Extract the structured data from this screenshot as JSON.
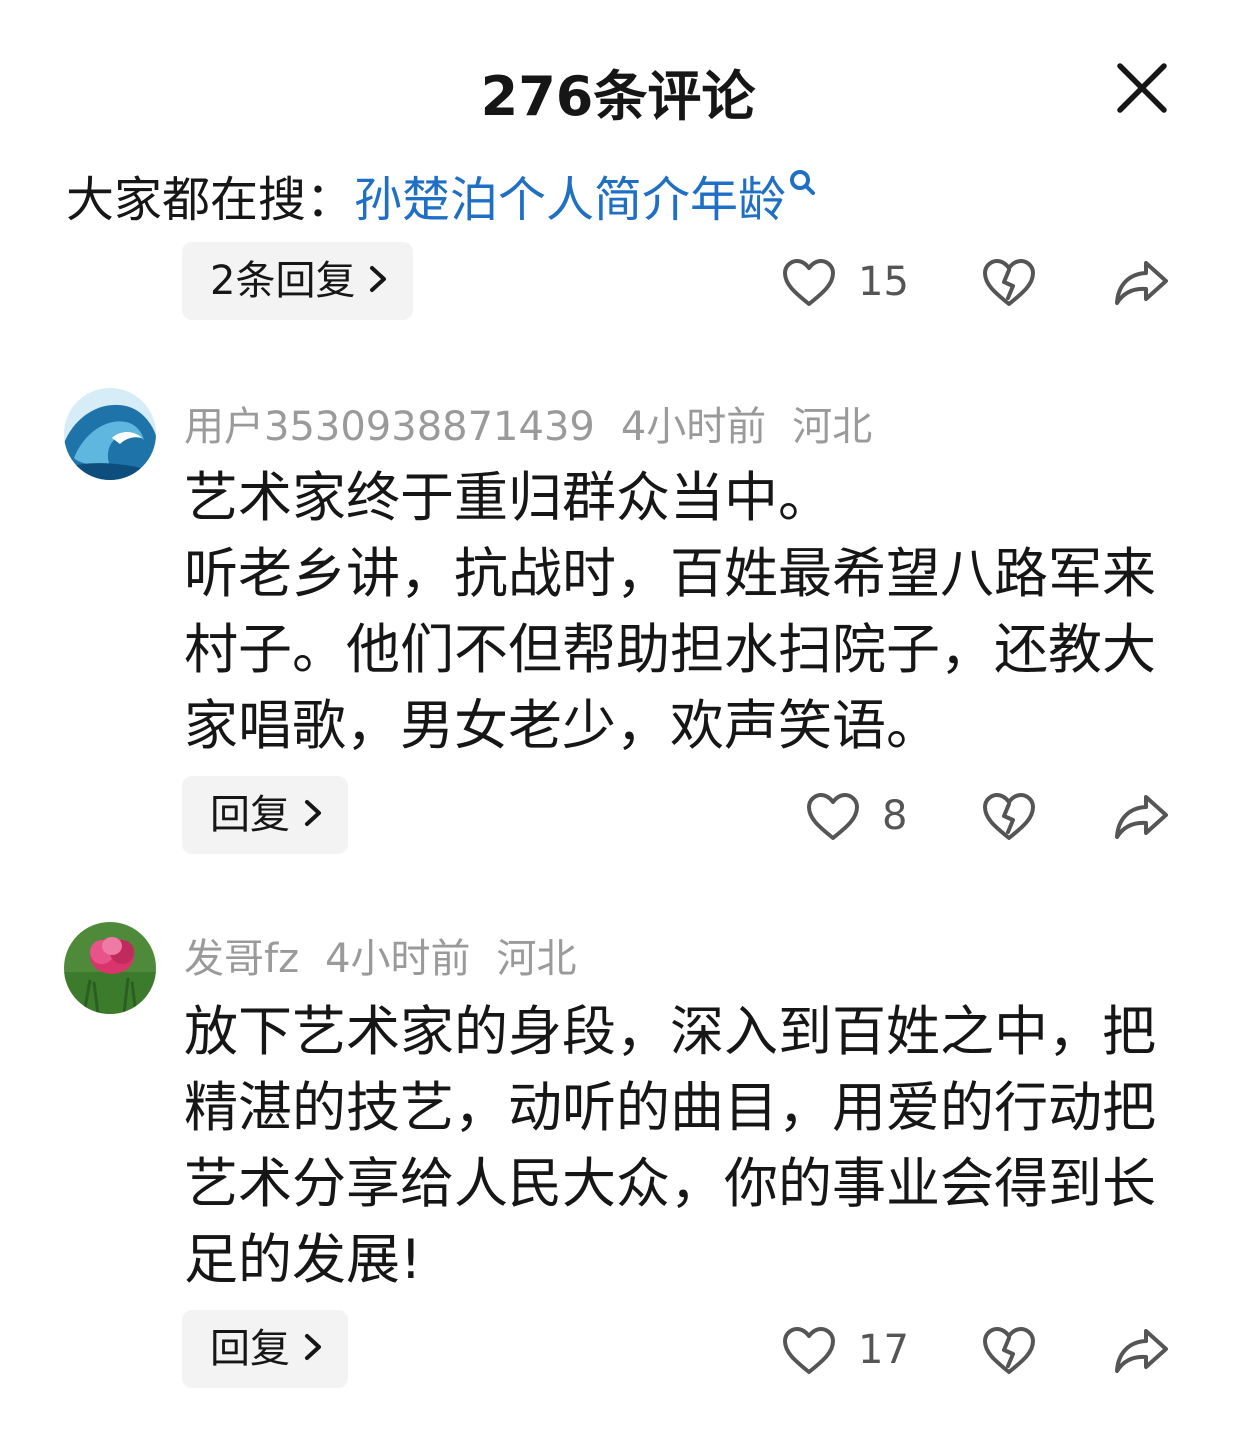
{
  "header": {
    "title": "276条评论"
  },
  "hot_search": {
    "label": "大家都在搜：",
    "query": "孙楚泊个人简介年龄"
  },
  "top_partial": {
    "reply_label": "2条回复",
    "likes": "15"
  },
  "comments": [
    {
      "username": "用户3530938871439",
      "time": "4小时前",
      "location": "河北",
      "lines": [
        "艺术家终于重归群众当中。",
        "听老乡讲，抗战时，百姓最希望八路军来村子。他们不但帮助担水扫院子，还教大家唱歌，男女老少，欢声笑语。"
      ],
      "reply_label": "回复",
      "likes": "8",
      "avatar_icon": "ocean-wave-avatar"
    },
    {
      "username": "发哥fz",
      "time": "4小时前",
      "location": "河北",
      "lines": [
        "放下艺术家的身段，深入到百姓之中，把精湛的技艺，动听的曲目，用爱的行动把艺术分享给人民大众，你的事业会得到长足的发展!"
      ],
      "reply_label": "回复",
      "likes": "17",
      "avatar_icon": "pink-flower-avatar"
    }
  ],
  "colors": {
    "link": "#1f6fc5",
    "meta": "#9a9a9a",
    "text": "#161616",
    "button_bg": "#f3f3f3"
  }
}
